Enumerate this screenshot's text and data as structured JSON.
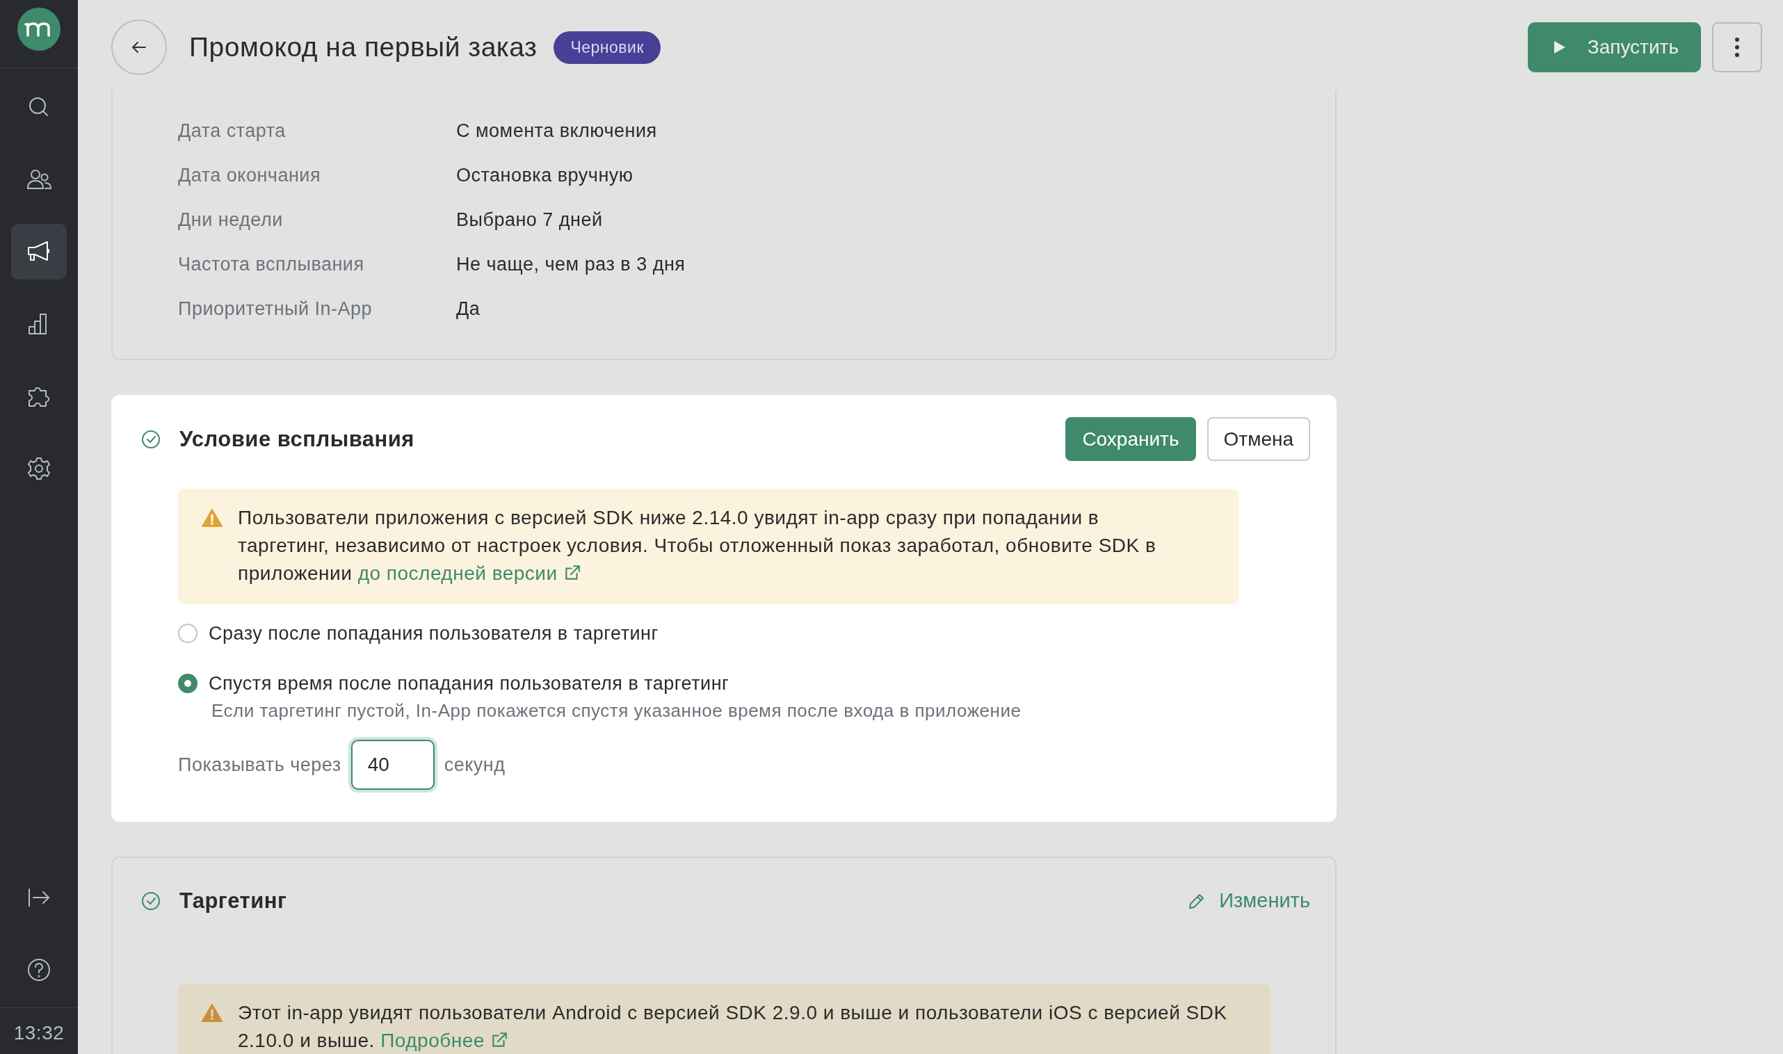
{
  "sidebar": {
    "top_items": [
      {
        "kind": "search",
        "selected": false
      },
      {
        "kind": "users",
        "selected": false
      },
      {
        "kind": "megaphone",
        "selected": true
      },
      {
        "kind": "chart",
        "selected": false
      },
      {
        "kind": "puzzle",
        "selected": false
      },
      {
        "kind": "gear",
        "selected": false
      }
    ],
    "bottom_items": [
      {
        "kind": "logout",
        "selected": false
      },
      {
        "kind": "help",
        "selected": false
      }
    ],
    "time": "13:32"
  },
  "header": {
    "title": "Промокод на первый заказ",
    "status_badge": "Черновик",
    "run_button": "Запустить"
  },
  "schedule_card": {
    "rows": [
      {
        "label": "Дата старта",
        "value": "С момента включения"
      },
      {
        "label": "Дата окончания",
        "value": "Остановка вручную"
      },
      {
        "label": "Дни недели",
        "value": "Выбрано 7 дней"
      },
      {
        "label": "Частота всплывания",
        "value": "Не чаще, чем раз в 3 дня"
      },
      {
        "label": "Приоритетный In-App",
        "value": "Да"
      }
    ]
  },
  "condition_card": {
    "title": "Условие всплывания",
    "save_button": "Сохранить",
    "cancel_button": "Отмена",
    "alert": {
      "text": "Пользователи приложения с версией SDK ниже 2.14.0 увидят in-app сразу при попадании в таргетинг, независимо от настроек условия. Чтобы отложенный показ заработал, обновите SDK в приложении",
      "link": "до последней версии"
    },
    "options": [
      {
        "label": "Сразу после попадания пользователя в таргетинг",
        "selected": false
      },
      {
        "label": "Спустя время после попадания пользователя в таргетинг",
        "hint": "Если таргетинг пустой, In-App покажется спустя указанное время после входа в приложение",
        "selected": true
      }
    ],
    "delay": {
      "label": "Показывать через",
      "value": "40",
      "unit": "секунд"
    }
  },
  "targeting_card": {
    "title": "Таргетинг",
    "edit_button": "Изменить",
    "alert": {
      "text": "Этот in-app увидят пользователи Android с версией SDK 2.9.0 и выше и пользователи iOS с версией SDK 2.10.0 и выше.",
      "link": "Подробнее"
    }
  }
}
